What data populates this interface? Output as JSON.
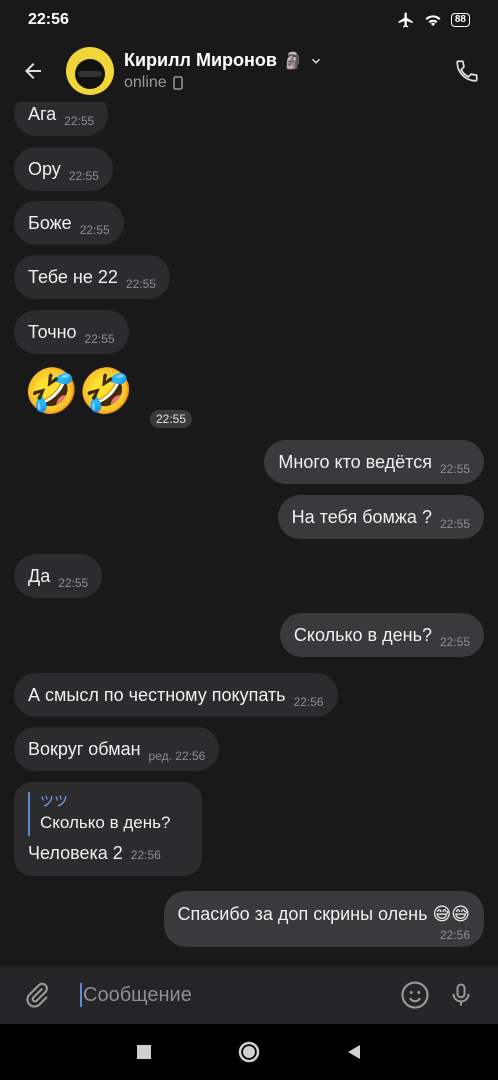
{
  "status_bar": {
    "time": "22:56",
    "battery": "88"
  },
  "header": {
    "name": "Кирилл Миронов",
    "name_emoji": "🗿",
    "status": "online"
  },
  "messages": [
    {
      "text": "Ага",
      "time": "22:55",
      "dir": "in"
    },
    {
      "text": "Ору",
      "time": "22:55",
      "dir": "in"
    },
    {
      "text": "Боже",
      "time": "22:55",
      "dir": "in"
    },
    {
      "text": "Тебе не 22",
      "time": "22:55",
      "dir": "in"
    },
    {
      "text": "Точно",
      "time": "22:55",
      "dir": "in"
    },
    {
      "text": "🤣🤣",
      "time": "22:55",
      "dir": "in"
    },
    {
      "text": "Много кто ведётся",
      "time": "22:55",
      "dir": "out"
    },
    {
      "text": "На тебя бомжа ?",
      "time": "22:55",
      "dir": "out"
    },
    {
      "text": "Да",
      "time": "22:55",
      "dir": "in"
    },
    {
      "text": "Сколько в день?",
      "time": "22:55",
      "dir": "out"
    },
    {
      "text": "А смысл по честному покупать",
      "time": "22:56",
      "dir": "in"
    },
    {
      "text": "Вокруг обман",
      "time": "ред. 22:56",
      "dir": "in"
    },
    {
      "text": "Человека 2",
      "time": "22:56",
      "dir": "in",
      "reply_author": "ツツ",
      "reply_text": "Сколько в день?"
    },
    {
      "text": "Спасибо за доп скрины олень 😅😅",
      "time": "22:56",
      "dir": "out"
    }
  ],
  "composer": {
    "placeholder": "Сообщение"
  }
}
